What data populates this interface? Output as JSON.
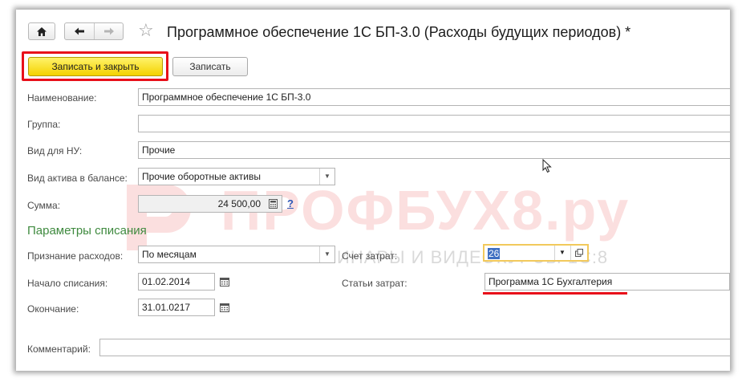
{
  "header": {
    "title": "Программное обеспечение 1С БП-3.0 (Расходы будущих периодов) *"
  },
  "toolbar": {
    "save_close_label": "Записать и закрыть",
    "save_label": "Записать"
  },
  "form": {
    "name_label": "Наименование:",
    "name_value": "Программное обеспечение 1С БП-3.0",
    "group_label": "Группа:",
    "group_value": "",
    "nu_type_label": "Вид для НУ:",
    "nu_type_value": "Прочие",
    "asset_type_label": "Вид актива в балансе:",
    "asset_type_value": "Прочие оборотные активы",
    "sum_label": "Сумма:",
    "sum_value": "24 500,00",
    "help_label": "?"
  },
  "writeoff": {
    "section_title": "Параметры списания",
    "recognition_label": "Признание расходов:",
    "recognition_value": "По месяцам",
    "start_label": "Начало списания:",
    "start_value": "01.02.2014",
    "end_label": "Окончание:",
    "end_value": "31.01.0217",
    "account_label": "Счет затрат:",
    "account_value": "26",
    "cost_item_label": "Статьи затрат:",
    "cost_item_value": "Программа 1С Бухгалтерия"
  },
  "comment": {
    "label": "Комментарий:",
    "value": ""
  },
  "watermark": {
    "brand": "ПРОФБУХ8.ру",
    "tagline": "ОНЛАЙН-СЕМИНАРЫ И ВИДЕОКУРСЫ 1С:8"
  },
  "colors": {
    "accent_red": "#e8101a",
    "primary_yellow": "#f4d200",
    "section_green": "#3f8a3f",
    "selection_blue": "#3f6fc2"
  }
}
